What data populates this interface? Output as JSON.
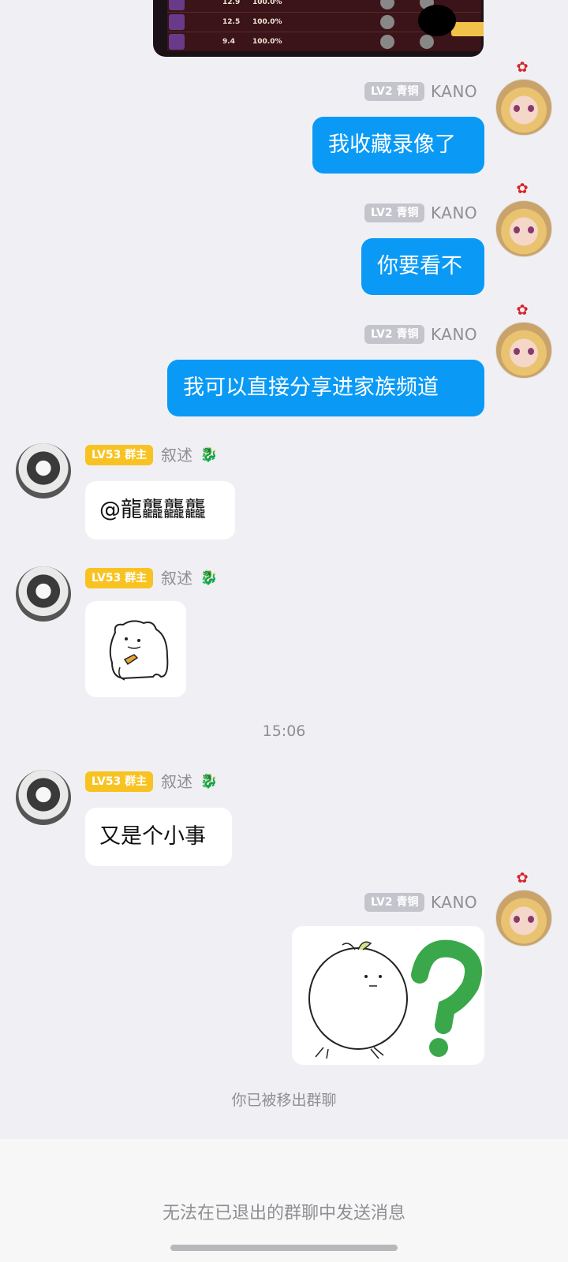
{
  "game_screenshot": {
    "rows": [
      {
        "value": "12.9",
        "percent": "100.0%"
      },
      {
        "value": "12.5",
        "percent": "100.0%"
      },
      {
        "value": "9.4",
        "percent": "100.0%"
      }
    ]
  },
  "messages": [
    {
      "sender": "KANO",
      "tag": "LV2 青铜",
      "text": "我收藏录像了"
    },
    {
      "sender": "KANO",
      "tag": "LV2 青铜",
      "text": "你要看不"
    },
    {
      "sender": "KANO",
      "tag": "LV2 青铜",
      "text": "我可以直接分享进家族频道"
    },
    {
      "sender": "叙述",
      "tag": "LV53 群主",
      "text": "@龍龘龘龘"
    },
    {
      "sender": "叙述",
      "tag": "LV53 群主",
      "sticker": "bear-sticker"
    },
    {
      "sender": "叙述",
      "tag": "LV53 群主",
      "text": "又是个小事"
    },
    {
      "sender": "KANO",
      "tag": "LV2 青铜",
      "sticker": "chick-question-sticker"
    }
  ],
  "timestamp": "15:06",
  "system_notice": "你已被移出群聊",
  "footer": {
    "disabled_input_text": "无法在已退出的群聊中发送消息"
  },
  "colors": {
    "outgoing_bubble": "#0a9af6",
    "lv53_tag": "#f8c322",
    "lv2_tag": "#c4c4cc",
    "background": "#f0f0f4"
  }
}
